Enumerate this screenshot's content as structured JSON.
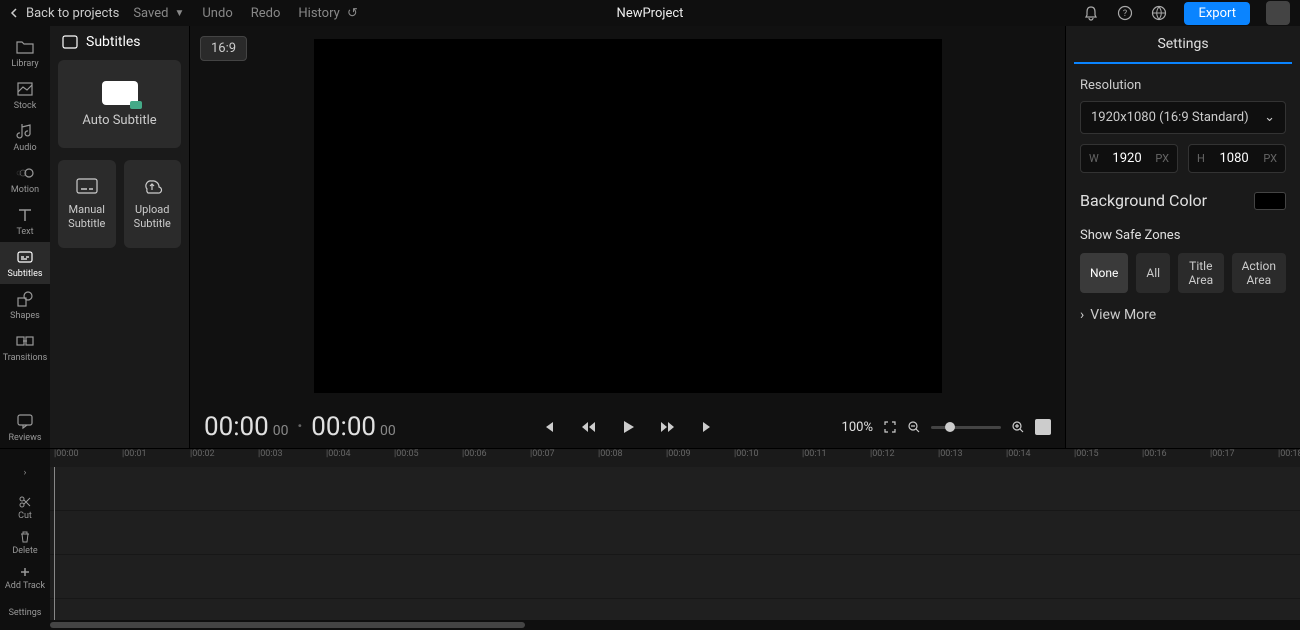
{
  "topbar": {
    "back_label": "Back to projects",
    "saved_label": "Saved",
    "undo_label": "Undo",
    "redo_label": "Redo",
    "history_label": "History",
    "project_name": "NewProject",
    "export_label": "Export"
  },
  "sidebar": {
    "items": [
      {
        "label": "Library"
      },
      {
        "label": "Stock"
      },
      {
        "label": "Audio"
      },
      {
        "label": "Motion"
      },
      {
        "label": "Text"
      },
      {
        "label": "Subtitles"
      },
      {
        "label": "Shapes"
      },
      {
        "label": "Transitions"
      },
      {
        "label": "Reviews"
      }
    ]
  },
  "subpanel": {
    "title": "Subtitles",
    "auto_label": "Auto Subtitle",
    "manual_label": "Manual Subtitle",
    "upload_label": "Upload Subtitle"
  },
  "preview": {
    "aspect": "16:9",
    "time_current": "00:00",
    "time_current_frames": "00",
    "time_total": "00:00",
    "time_total_frames": "00",
    "zoom_percent": "100%"
  },
  "settings": {
    "tab": "Settings",
    "resolution_label": "Resolution",
    "resolution_value": "1920x1080 (16:9 Standard)",
    "w_label": "W",
    "w_value": "1920",
    "h_label": "H",
    "h_value": "1080",
    "px": "PX",
    "bg_label": "Background Color",
    "bg_color": "#000000",
    "safe_label": "Show Safe Zones",
    "safe_options": [
      "None",
      "All",
      "Title Area",
      "Action Area"
    ],
    "safe_active": "None",
    "view_more": "View More"
  },
  "timeline": {
    "tools": [
      {
        "label": "Cut"
      },
      {
        "label": "Delete"
      },
      {
        "label": "Add Track"
      },
      {
        "label": "Settings"
      }
    ],
    "ruler": [
      "00:00",
      "00:01",
      "00:02",
      "00:03",
      "00:04",
      "00:05",
      "00:06",
      "00:07",
      "00:08",
      "00:09",
      "00:10",
      "00:11",
      "00:12",
      "00:13",
      "00:14",
      "00:15",
      "00:16",
      "00:17",
      "00:18"
    ]
  }
}
